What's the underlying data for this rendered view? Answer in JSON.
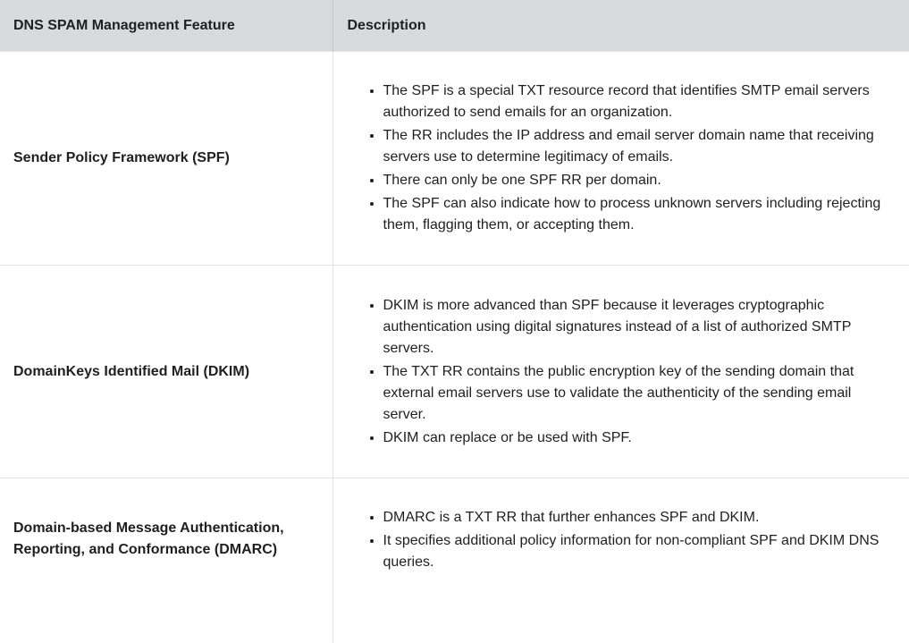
{
  "table": {
    "headers": [
      "DNS SPAM Management Feature",
      "Description"
    ],
    "rows": [
      {
        "feature": "Sender Policy Framework (SPF)",
        "bullets": [
          "The SPF is a special TXT resource record that identifies SMTP email servers authorized to send emails for an organization.",
          "The RR includes the IP address and email server domain name that receiving servers use to determine legitimacy of emails.",
          "There can only be one SPF RR per domain.",
          "The SPF can also indicate how to process unknown servers including rejecting them, flagging them, or accepting them."
        ]
      },
      {
        "feature": "DomainKeys Identified Mail (DKIM)",
        "bullets": [
          "DKIM is more advanced than SPF because it leverages cryptographic authentication using digital signatures instead of a list of authorized SMTP servers.",
          "The TXT RR contains the public encryption key of the sending domain that external email servers use to validate the authenticity of the sending email server.",
          "DKIM can replace or be used with SPF."
        ]
      },
      {
        "feature_lines": [
          "Domain-based Message Authentication,",
          "Reporting, and Conformance (DMARC)"
        ],
        "bullets": [
          "DMARC is a TXT RR that further enhances SPF and DKIM.",
          "It specifies additional policy information for non-compliant SPF and DKIM DNS queries."
        ]
      }
    ]
  }
}
